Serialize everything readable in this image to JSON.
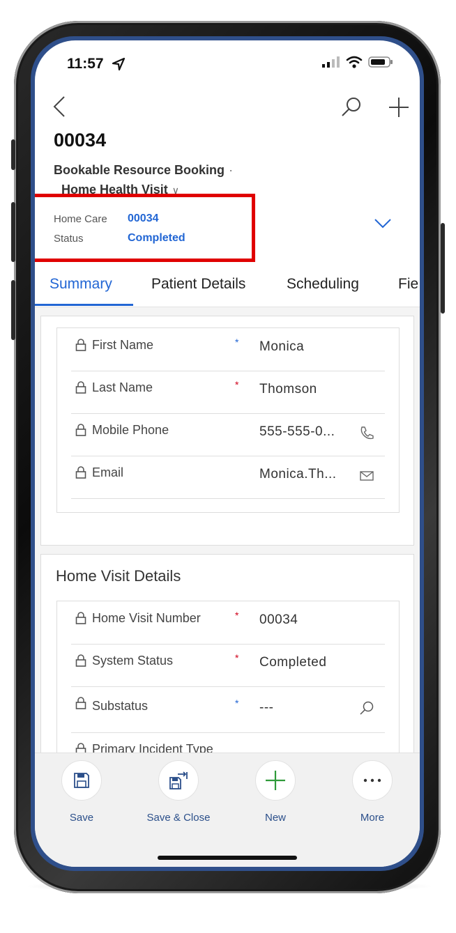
{
  "status_bar": {
    "time": "11:57"
  },
  "header": {
    "record_number": "00034",
    "entity": "Bookable Resource Booking",
    "separator": "·",
    "form_name": "Home Health Visit",
    "form_chevron": "∨"
  },
  "header_fields": [
    {
      "label": "Home Care",
      "value": "00034"
    },
    {
      "label": "Status",
      "value": "Completed"
    }
  ],
  "tabs": [
    {
      "label": "Summary"
    },
    {
      "label": "Patient Details"
    },
    {
      "label": "Scheduling"
    },
    {
      "label": "Fie"
    }
  ],
  "patient_section": {
    "fields": [
      {
        "label": "First Name",
        "required": "*",
        "value": "Monica"
      },
      {
        "label": "Last Name",
        "required": "*",
        "value": "Thomson"
      },
      {
        "label": "Mobile Phone",
        "required": "",
        "value": "555-555-0...",
        "icon": "phone-icon"
      },
      {
        "label": "Email",
        "required": "",
        "value": "Monica.Th...",
        "icon": "email-icon"
      }
    ]
  },
  "visit_section": {
    "title": "Home Visit Details",
    "fields": [
      {
        "label": "Home Visit Number",
        "required": "*",
        "value": "00034"
      },
      {
        "label": "System Status",
        "required": "*",
        "value": "Completed"
      },
      {
        "label": "Substatus",
        "required": "*",
        "value": "---",
        "icon": "search-icon"
      },
      {
        "label": "Primary Incident Type",
        "required": "",
        "value": ""
      }
    ]
  },
  "commands": [
    {
      "label": "Save",
      "icon": "save-icon"
    },
    {
      "label": "Save & Close",
      "icon": "save-close-icon"
    },
    {
      "label": "New",
      "icon": "plus-icon"
    },
    {
      "label": "More",
      "icon": "ellipsis-icon"
    }
  ],
  "colors": {
    "accent": "#2266d4",
    "required": "#d0021b",
    "highlight": "#e00000"
  }
}
